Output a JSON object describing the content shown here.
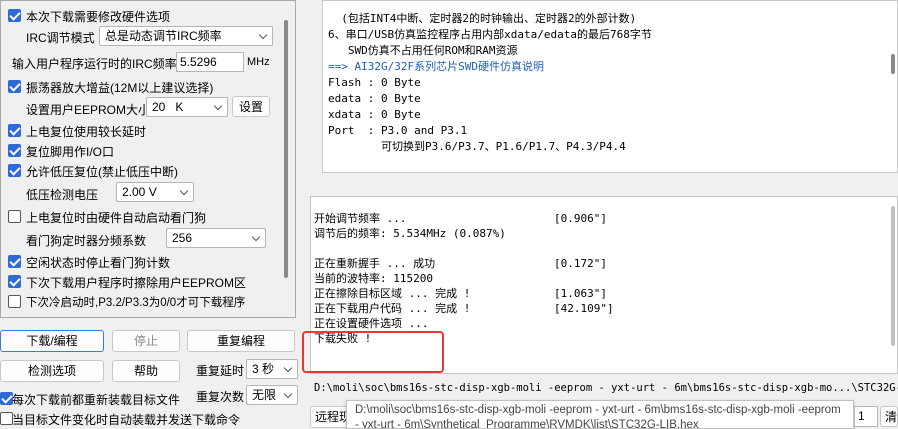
{
  "options": {
    "change_hw": "本次下载需要修改硬件选项",
    "irc_mode_label": "IRC调节模式",
    "irc_mode_value": "总是动态调节IRC频率",
    "irc_freq_label": "输入用户程序运行时的IRC频率",
    "irc_freq_value": "5.5296",
    "irc_freq_unit": "MHz",
    "osc_gain": "振荡器放大增益(12M以上建议选择)",
    "eeprom_label": "设置用户EEPROM大小",
    "eeprom_value": "20   K",
    "eeprom_button": "设置",
    "reset_long_delay": "上电复位使用较长延时",
    "reset_pin_io": "复位脚用作I/O口",
    "lvd_reset": "允许低压复位(禁止低压中断)",
    "lvd_voltage_label": "低压检测电压",
    "lvd_voltage_value": "2.00 V",
    "wdt_hw_start": "上电复位时由硬件自动启动看门狗",
    "wdt_div_label": "看门狗定时器分频系数",
    "wdt_div_value": "256",
    "idle_stop_wdt": "空闲状态时停止看门狗计数",
    "erase_eeprom": "下次下载用户程序时擦除用户EEPROM区",
    "cold_boot": "下次冷启动时,P3.2/P3.3为0/0才可下载程序"
  },
  "buttons": {
    "download": "下载/编程",
    "stop": "停止",
    "reprogram": "重复编程",
    "check": "检测选项",
    "help": "帮助",
    "repeat_delay_label": "重复延时",
    "repeat_delay_value": "3 秒",
    "repeat_count_label": "重复次数",
    "repeat_count_value": "无限",
    "reload_each": "每次下载前都重新装载目标文件",
    "auto_send": "当目标文件变化时自动装载并发送下载命令"
  },
  "info_lines": [
    "  (包括INT4中断、定时器2的时钟输出、定时器2的外部计数)",
    "6、串口/USB仿真监控程序占用内部xdata/edata的最后768字节",
    "   SWD仿真不占用任何ROM和RAM资源",
    "",
    "==> AI32G/32F系列芯片SWD硬件仿真说明",
    "Flash : 0 Byte",
    "edata : 0 Byte",
    "xdata : 0 Byte",
    "Port  : P3.0 and P3.1",
    "        可切换到P3.6/P3.7、P1.6/P1.7、P4.3/P4.4"
  ],
  "log_lines": [
    {
      "text": "开始调节频率 ...",
      "time": "[0.906\"]"
    },
    {
      "text": "调节后的频率: 5.534MHz (0.087%)",
      "time": ""
    },
    {
      "text": "",
      "time": ""
    },
    {
      "text": "正在重新握手 ... 成功",
      "time": "[0.172\"]"
    },
    {
      "text": "当前的波特率: 115200",
      "time": ""
    },
    {
      "text": "正在擦除目标区域 ... 完成 !",
      "time": "[1.063\"]"
    },
    {
      "text": "正在下载用户代码 ... 完成 !",
      "time": "[42.109\"]"
    },
    {
      "text": "正在设置硬件选项 ...",
      "time": ""
    },
    {
      "text": "下载失败 !",
      "time": ""
    }
  ],
  "path_bar": "D:\\moli\\soc\\bms16s-stc-disp-xgb-moli -eeprom - yxt-urt - 6m\\bms16s-stc-disp-xgb-mo...\\STC32G-LIB.h",
  "tooltip": "D:\\moli\\soc\\bms16s-stc-disp-xgb-moli -eeprom - yxt-urt - 6m\\bms16s-stc-disp-xgb-moli -eeprom - yxt-urt - 6m\\Synthetical_Programme\\RVMDK\\list\\STC32G-LIB.hex",
  "bottom_left": "远程现",
  "bottom_right_num": "1",
  "bottom_right_btn": "清",
  "colors": {
    "accent": "#2f6bd6",
    "highlight": "#e53935",
    "info_blue": "#1f5fb8"
  }
}
